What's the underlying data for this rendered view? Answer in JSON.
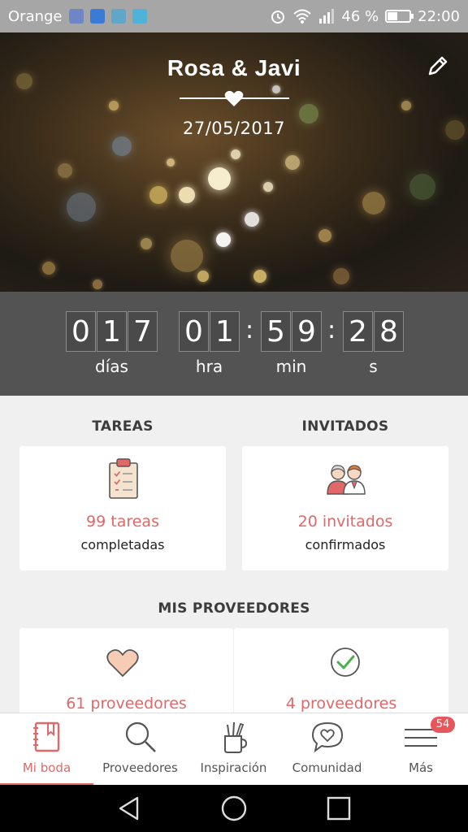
{
  "status_bar": {
    "carrier": "Orange",
    "battery_percent": "46 %",
    "battery_level": 0.46,
    "time": "22:00"
  },
  "hero": {
    "title": "Rosa & Javi",
    "date": "27/05/2017",
    "edit_icon": "pencil-icon"
  },
  "countdown": {
    "days": [
      "0",
      "1",
      "7"
    ],
    "hours": [
      "0",
      "1"
    ],
    "minutes": [
      "5",
      "9"
    ],
    "seconds": [
      "2",
      "8"
    ],
    "separator": ":",
    "labels": {
      "days": "días",
      "hours": "hra",
      "minutes": "min",
      "seconds": "s"
    }
  },
  "sections": {
    "tasks": {
      "title": "TAREAS",
      "count": "99 tareas",
      "sub": "completadas",
      "icon": "clipboard-icon"
    },
    "guests": {
      "title": "INVITADOS",
      "count": "20 invitados",
      "sub": "confirmados",
      "icon": "couple-icon"
    },
    "providers": {
      "title": "MIS PROVEEDORES",
      "saved_count": "61 proveedores",
      "saved_icon": "heart-icon",
      "hired_count": "4 proveedores",
      "hired_icon": "check-circle-icon"
    }
  },
  "bottom_nav": [
    {
      "label": "Mi boda",
      "icon": "notebook-icon",
      "active": true
    },
    {
      "label": "Proveedores",
      "icon": "search-icon",
      "active": false
    },
    {
      "label": "Inspiración",
      "icon": "pencil-cup-icon",
      "active": false
    },
    {
      "label": "Comunidad",
      "icon": "chat-heart-icon",
      "active": false
    },
    {
      "label": "Más",
      "icon": "menu-icon",
      "active": false,
      "badge": "54"
    }
  ],
  "colors": {
    "accent": "#e06868",
    "countdown_bg": "#535353",
    "status_bar_bg": "#a6a6a6",
    "content_bg": "#f0f0f0"
  }
}
